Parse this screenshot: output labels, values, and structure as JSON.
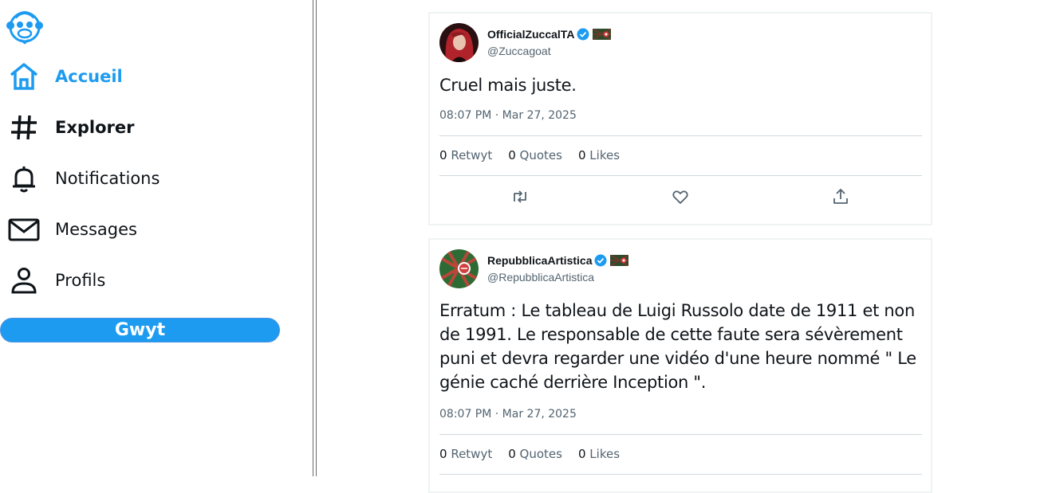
{
  "sidebar": {
    "logo_icon": "monkey-logo-icon",
    "nav": [
      {
        "label": "Accueil",
        "icon": "home-icon",
        "active": true
      },
      {
        "label": "Explorer",
        "icon": "hashtag-icon"
      },
      {
        "label": "Notifications",
        "icon": "bell-icon"
      },
      {
        "label": "Messages",
        "icon": "mail-icon"
      },
      {
        "label": "Profils",
        "icon": "profile-icon"
      }
    ],
    "post_button": "Gwyt"
  },
  "tweets": [
    {
      "display_name": "OfficialZuccalTA",
      "handle": "@Zuccagoat",
      "verified": true,
      "text": "Cruel mais juste.",
      "timestamp": "08:07 PM · Mar 27, 2025",
      "stats": {
        "retweets": "0",
        "retweets_label": "Retwyt",
        "quotes": "0",
        "quotes_label": "Quotes",
        "likes": "0",
        "likes_label": "Likes"
      }
    },
    {
      "display_name": "RepubblicaArtistica",
      "handle": "@RepubblicaArtistica",
      "verified": true,
      "text": "Erratum : Le tableau de Luigi Russolo date de 1911 et non de 1991. Le responsable de cette faute sera sévèrement puni et devra regarder une vidéo d'une heure nommé \" Le génie caché derrière Inception \".",
      "timestamp": "08:07 PM · Mar 27, 2025",
      "stats": {
        "retweets": "0",
        "retweets_label": "Retwyt",
        "quotes": "0",
        "quotes_label": "Quotes",
        "likes": "0",
        "likes_label": "Likes"
      }
    }
  ],
  "colors": {
    "accent": "#1d9bf0",
    "muted": "#536471",
    "border": "#eff3f4"
  }
}
